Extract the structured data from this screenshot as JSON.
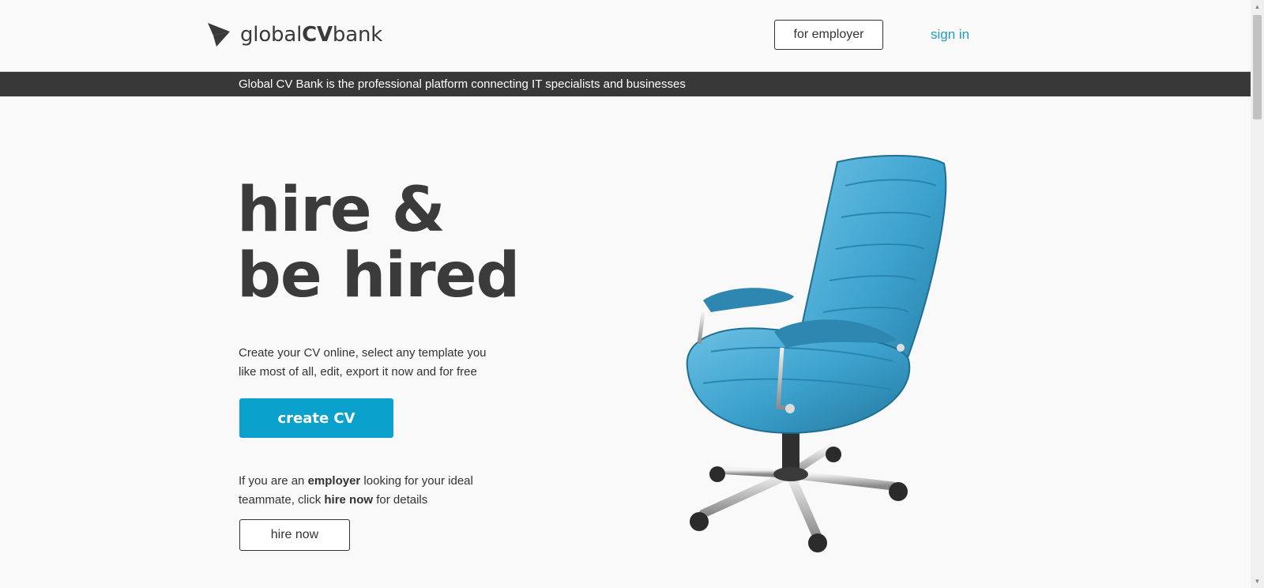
{
  "header": {
    "logo": {
      "prefix": "global",
      "bold": "CV",
      "suffix": "bank",
      "icon": "paper-plane-logo-icon"
    },
    "employer_button": "for employer",
    "signin_link": "sign in"
  },
  "banner": {
    "text": "Global CV Bank is the professional platform connecting IT specialists and businesses"
  },
  "hero": {
    "headline_line1": "hire &",
    "headline_line2": "be hired",
    "subtext": "Create your CV online,  select any template you like most of all, edit, export it now and for free",
    "create_button": "create CV",
    "employer_text": {
      "part1": "If you are an ",
      "bold1": "employer",
      "part2": " looking for your ideal teammate, click ",
      "bold2": "hire now",
      "part3": " for details"
    },
    "hire_button": "hire now",
    "image": "office-chair-image"
  },
  "colors": {
    "accent": "#0aa1cc",
    "link": "#229ac7",
    "banner": "#383838",
    "text": "#3b3b3b"
  }
}
